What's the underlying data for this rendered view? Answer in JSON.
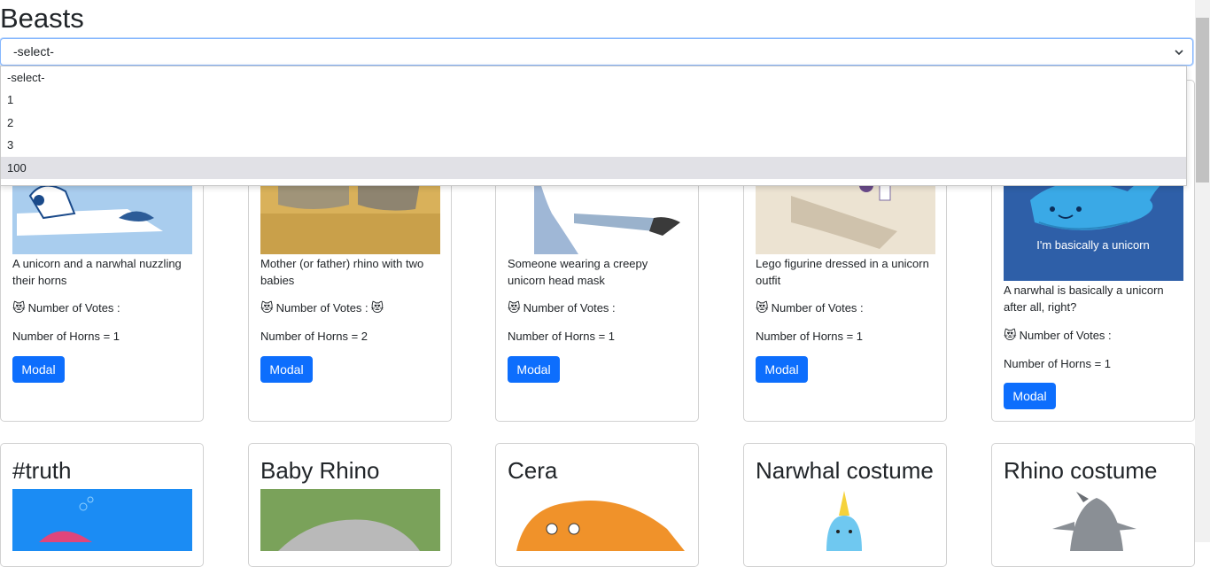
{
  "page": {
    "title": "Beasts"
  },
  "select": {
    "value": "-select-",
    "options": [
      "-select-",
      "1",
      "2",
      "3",
      "100"
    ],
    "highlighted": "100"
  },
  "emoji": "😻",
  "cards_row1": [
    {
      "description": "A unicorn and a narwhal nuzzling their horns",
      "votes_label": "Number of Votes :",
      "votes_value": "",
      "horns_label": "Number of Horns = ",
      "horns": "1",
      "button": "Modal"
    },
    {
      "description": "Mother (or father) rhino with two babies",
      "votes_label": "Number of Votes :",
      "votes_value": "😻",
      "horns_label": "Number of Horns = ",
      "horns": "2",
      "button": "Modal"
    },
    {
      "description": "Someone wearing a creepy unicorn head mask",
      "votes_label": "Number of Votes :",
      "votes_value": "",
      "horns_label": "Number of Horns = ",
      "horns": "1",
      "button": "Modal"
    },
    {
      "description": "Lego figurine dressed in a unicorn outfit",
      "votes_label": "Number of Votes :",
      "votes_value": "",
      "horns_label": "Number of Horns = ",
      "horns": "1",
      "button": "Modal"
    },
    {
      "description": "A narwhal is basically a unicorn after all, right?",
      "votes_label": "Number of Votes :",
      "votes_value": "",
      "horns_label": "Number of Horns = ",
      "horns": "1",
      "button": "Modal",
      "image_caption": "I'm basically a unicorn"
    }
  ],
  "cards_row2": [
    {
      "title": "#truth"
    },
    {
      "title": "Baby Rhino"
    },
    {
      "title": "Cera"
    },
    {
      "title": "Narwhal costume"
    },
    {
      "title": "Rhino costume"
    }
  ]
}
